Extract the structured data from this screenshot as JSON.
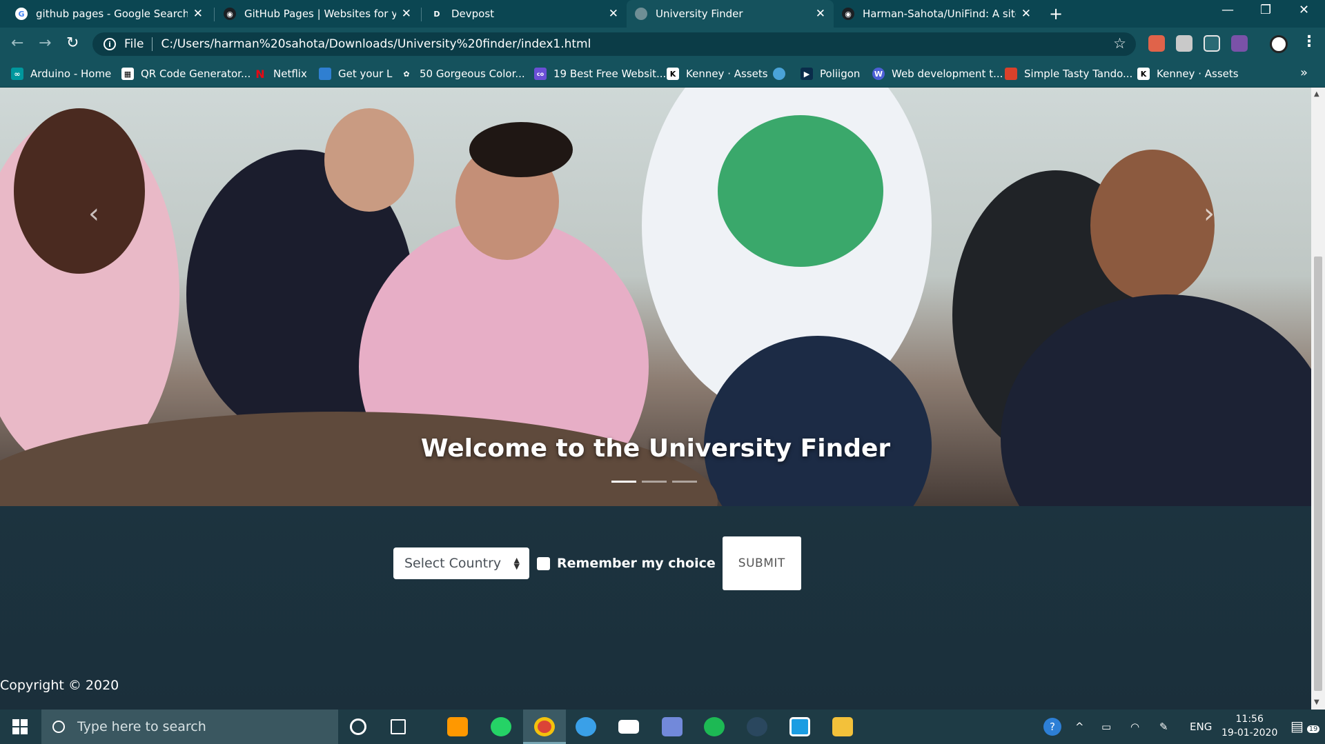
{
  "browser": {
    "tabs": [
      {
        "title": "github pages - Google Search",
        "icon": "google-icon",
        "active": false
      },
      {
        "title": "GitHub Pages | Websites for you",
        "icon": "github-icon",
        "active": false
      },
      {
        "title": "Devpost",
        "icon": "devpost-icon",
        "active": false
      },
      {
        "title": "University Finder",
        "icon": "globe-icon",
        "active": true
      },
      {
        "title": "Harman-Sahota/UniFind: A site b",
        "icon": "github-icon",
        "active": false
      }
    ],
    "address": {
      "scheme": "File",
      "url": "C:/Users/harman%20sahota/Downloads/University%20finder/index1.html"
    },
    "bookmarks": [
      "Arduino - Home",
      "QR Code Generator...",
      "Netflix",
      "Get your L",
      "50 Gorgeous Color...",
      "19 Best Free Websit...",
      "Kenney · Assets",
      "",
      "Poliigon",
      "Web development t...",
      "Simple Tasty Tando...",
      "Kenney · Assets"
    ]
  },
  "page": {
    "hero_caption": "Welcome to the University Finder",
    "carousel_slides": 3,
    "carousel_active": 0,
    "form": {
      "country_select": "Select Country",
      "remember_label": "Remember my choice",
      "submit_label": "SUBMIT"
    },
    "footer": "Copyright © 2020"
  },
  "taskbar": {
    "search_placeholder": "Type here to search",
    "language": "ENG",
    "time": "11:56",
    "date": "19-01-2020",
    "notifications": "19"
  },
  "colors": {
    "titlebar": "#0b4652",
    "toolbar": "#15525d",
    "page_bg": "#1f3a44",
    "taskbar": "#1e3b45"
  }
}
